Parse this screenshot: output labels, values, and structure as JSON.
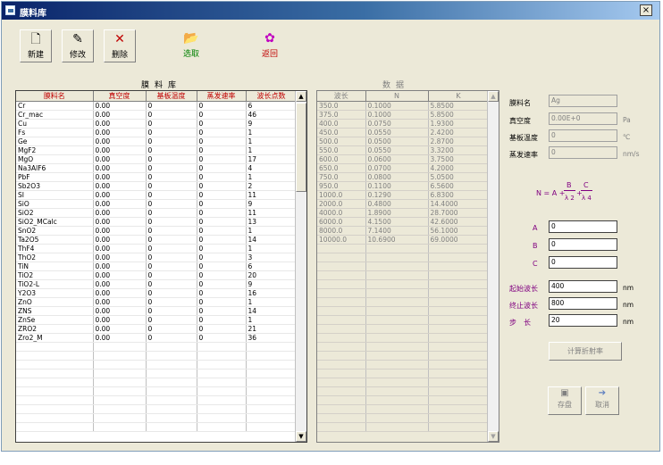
{
  "window": {
    "title": "膜料库",
    "close_glyph": "×"
  },
  "toolbar": [
    {
      "label": "新建",
      "icon": "new-doc-icon",
      "glyph": "🗋",
      "color": "#000000"
    },
    {
      "label": "修改",
      "icon": "edit-icon",
      "glyph": "✎",
      "color": "#000000"
    },
    {
      "label": "删除",
      "icon": "delete-icon",
      "glyph": "✕",
      "color": "#000000"
    },
    {
      "label": "选取",
      "icon": "select-icon",
      "glyph": "📂",
      "color": "#008000"
    },
    {
      "label": "返回",
      "icon": "return-icon",
      "glyph": "✿",
      "color": "#c00000"
    }
  ],
  "left_panel": {
    "title": "膜料库",
    "columns": [
      "膜料名",
      "真空度",
      "基板温度",
      "蒸发速率",
      "波长点数"
    ],
    "rows": [
      [
        "Cr",
        "0.00",
        "0",
        "0",
        "6"
      ],
      [
        "Cr_mac",
        "0.00",
        "0",
        "0",
        "46"
      ],
      [
        "Cu",
        "0.00",
        "0",
        "0",
        "9"
      ],
      [
        "Fs",
        "0.00",
        "0",
        "0",
        "1"
      ],
      [
        "Ge",
        "0.00",
        "0",
        "0",
        "1"
      ],
      [
        "MgF2",
        "0.00",
        "0",
        "0",
        "1"
      ],
      [
        "MgO",
        "0.00",
        "0",
        "0",
        "17"
      ],
      [
        "Na3AlF6",
        "0.00",
        "0",
        "0",
        "4"
      ],
      [
        "PbF",
        "0.00",
        "0",
        "0",
        "1"
      ],
      [
        "Sb2O3",
        "0.00",
        "0",
        "0",
        "2"
      ],
      [
        "SI",
        "0.00",
        "0",
        "0",
        "11"
      ],
      [
        "SiO",
        "0.00",
        "0",
        "0",
        "9"
      ],
      [
        "SiO2",
        "0.00",
        "0",
        "0",
        "11"
      ],
      [
        "SiO2_MCalc",
        "0.00",
        "0",
        "0",
        "13"
      ],
      [
        "SnO2",
        "0.00",
        "0",
        "0",
        "1"
      ],
      [
        "Ta2O5",
        "0.00",
        "0",
        "0",
        "14"
      ],
      [
        "ThF4",
        "0.00",
        "0",
        "0",
        "1"
      ],
      [
        "ThO2",
        "0.00",
        "0",
        "0",
        "3"
      ],
      [
        "TiN",
        "0.00",
        "0",
        "0",
        "6"
      ],
      [
        "TiO2",
        "0.00",
        "0",
        "0",
        "20"
      ],
      [
        "TiO2-L",
        "0.00",
        "0",
        "0",
        "9"
      ],
      [
        "Y2O3",
        "0.00",
        "0",
        "0",
        "16"
      ],
      [
        "ZnO",
        "0.00",
        "0",
        "0",
        "1"
      ],
      [
        "ZNS",
        "0.00",
        "0",
        "0",
        "14"
      ],
      [
        "ZnSe",
        "0.00",
        "0",
        "0",
        "1"
      ],
      [
        "ZRO2",
        "0.00",
        "0",
        "0",
        "21"
      ],
      [
        "Zro2_M",
        "0.00",
        "0",
        "0",
        "36"
      ]
    ],
    "empty_rows": 10
  },
  "data_panel": {
    "title": "数据",
    "columns": [
      "波长",
      "N",
      "K"
    ],
    "rows": [
      [
        "350.0",
        "0.1000",
        "5.8500"
      ],
      [
        "375.0",
        "0.1000",
        "5.8500"
      ],
      [
        "400.0",
        "0.0750",
        "1.9300"
      ],
      [
        "450.0",
        "0.0550",
        "2.4200"
      ],
      [
        "500.0",
        "0.0500",
        "2.8700"
      ],
      [
        "550.0",
        "0.0550",
        "3.3200"
      ],
      [
        "600.0",
        "0.0600",
        "3.7500"
      ],
      [
        "650.0",
        "0.0700",
        "4.2000"
      ],
      [
        "750.0",
        "0.0800",
        "5.0500"
      ],
      [
        "950.0",
        "0.1100",
        "6.5600"
      ],
      [
        "1000.0",
        "0.1290",
        "6.8300"
      ],
      [
        "2000.0",
        "0.4800",
        "14.4000"
      ],
      [
        "4000.0",
        "1.8900",
        "28.7000"
      ],
      [
        "6000.0",
        "4.1500",
        "42.6000"
      ],
      [
        "8000.0",
        "7.1400",
        "56.1000"
      ],
      [
        "10000.0",
        "10.6900",
        "69.0000"
      ]
    ],
    "empty_rows": 21
  },
  "properties": {
    "name_label": "膜料名",
    "name_value": "Ag",
    "vacuum_label": "真空度",
    "vacuum_value": "0.00E+0",
    "vacuum_unit": "Pa",
    "temp_label": "基板温度",
    "temp_value": "0",
    "temp_unit": "℃",
    "rate_label": "蒸发速率",
    "rate_value": "0",
    "rate_unit": "nm/s"
  },
  "formula": {
    "lhs": "N = A +",
    "b": "B",
    "c": "C",
    "den_b": "λ 2",
    "den_c": "λ 4"
  },
  "coefficients": {
    "a_label": "A",
    "a_value": "0",
    "b_label": "B",
    "b_value": "0",
    "c_label": "C",
    "c_value": "0"
  },
  "wavelength": {
    "start_label": "起始波长",
    "start_value": "400",
    "start_unit": "nm",
    "end_label": "终止波长",
    "end_value": "800",
    "end_unit": "nm",
    "step_label": "步　长",
    "step_value": "20",
    "step_unit": "nm"
  },
  "actions": {
    "compute": "计算折射率",
    "save": "存盘",
    "cancel": "取消"
  }
}
